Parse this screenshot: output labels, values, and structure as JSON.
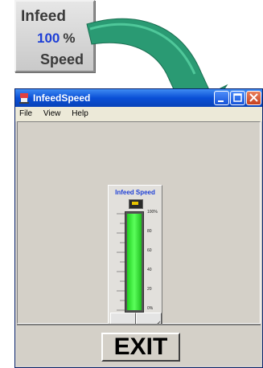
{
  "info_button": {
    "line1": "Infeed",
    "value": "100",
    "unit": "%",
    "line3": "Speed"
  },
  "window": {
    "title": "InfeedSpeed",
    "menu": [
      "File",
      "View",
      "Help"
    ]
  },
  "gauge": {
    "title": "Infeed Speed",
    "level_percent": 100,
    "scale": [
      "100%",
      "80",
      "60",
      "40",
      "20",
      "0%"
    ]
  },
  "buttons": {
    "exit": "EXIT"
  },
  "colors": {
    "fill": "#39e639",
    "value_text": "#1e3fd6",
    "arrow": "#2a9a73"
  },
  "icons": {
    "turtle": "turtle-icon",
    "rabbit": "rabbit-icon"
  }
}
